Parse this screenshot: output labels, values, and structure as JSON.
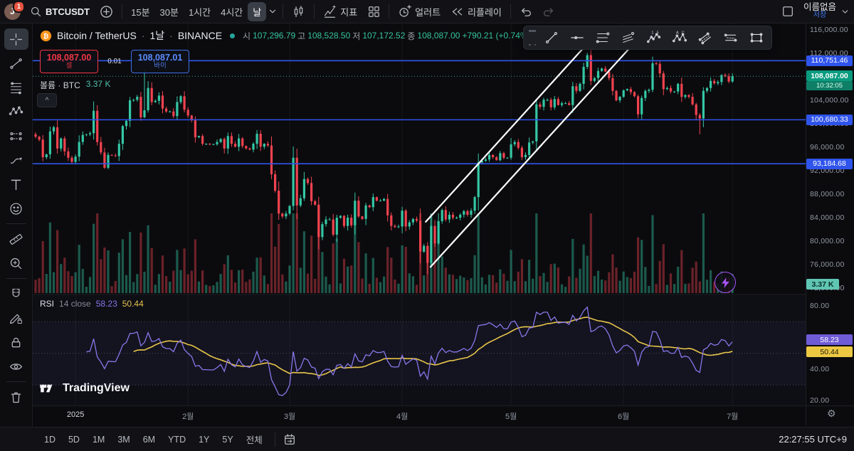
{
  "topbar": {
    "badge": "1",
    "avatar_letter": "J",
    "symbol": "BTCUSDT",
    "intervals": [
      "15분",
      "30분",
      "1시간",
      "4시간",
      "날"
    ],
    "selected_interval": "날",
    "indicators_label": "지표",
    "alert_label": "얼러트",
    "replay_label": "리플레이",
    "layout_name": "이름없음",
    "save_label": "저장"
  },
  "legend": {
    "name": "Bitcoin / TetherUS",
    "sep": "·",
    "interval": "1날",
    "exchange": "BINANCE",
    "o_label": "시",
    "o": "107,296.79",
    "h_label": "고",
    "h": "108,528.50",
    "l_label": "저",
    "l": "107,172.52",
    "c_label": "종",
    "c": "108,087.00",
    "change": "+790.21 (+0.74%)"
  },
  "volume_row": {
    "label": "볼륨 · BTC",
    "value": "3.37 K"
  },
  "rsi_row": {
    "title": "RSI",
    "params": "14 close",
    "v1": "58.23",
    "v2": "50.44"
  },
  "trade": {
    "sell_price": "108,087.00",
    "sell_label": "셀",
    "spread": "0.01",
    "buy_price": "108,087.01",
    "buy_label": "바이"
  },
  "logo_text": "TradingView",
  "collapse_glyph": "^",
  "gear_glyph": "⚙",
  "bottombar": {
    "ranges": [
      "1D",
      "5D",
      "1M",
      "3M",
      "6M",
      "YTD",
      "1Y",
      "5Y",
      "전체"
    ],
    "clock": "22:27:55 UTC+9"
  },
  "price_axis": {
    "ticks": [
      {
        "label": "116,000.00",
        "v": 116000
      },
      {
        "label": "112,000.00",
        "v": 112000
      },
      {
        "label": "104,000.00",
        "v": 104000
      },
      {
        "label": "100,000.00",
        "v": 100000
      },
      {
        "label": "96,000.00",
        "v": 96000
      },
      {
        "label": "92,000.00",
        "v": 92000
      },
      {
        "label": "88,000.00",
        "v": 88000
      },
      {
        "label": "84,000.00",
        "v": 84000
      },
      {
        "label": "80,000.00",
        "v": 80000
      },
      {
        "label": "76,000.00",
        "v": 76000
      },
      {
        "label": "72,000.00",
        "v": 72000
      }
    ],
    "rsi_ticks": [
      {
        "label": "80.00",
        "v": 80
      },
      {
        "label": "40.00",
        "v": 40
      },
      {
        "label": "20.00",
        "v": 20
      }
    ],
    "level_labels": [
      {
        "label": "110,751.46",
        "v": 110751.46
      },
      {
        "label": "100,680.33",
        "v": 100680.33
      },
      {
        "label": "93,184.68",
        "v": 93184.68
      }
    ],
    "last": {
      "label": "108,087.00",
      "countdown": "10:32:05"
    },
    "volume_label": "3.37 K",
    "rsi_value_labels": [
      {
        "label": "58.23",
        "kind": "rsi"
      },
      {
        "label": "50.44",
        "kind": "rsi-ma"
      }
    ]
  },
  "time_axis": {
    "labels": [
      {
        "text": "2025",
        "i": 11,
        "major": true
      },
      {
        "text": "2월",
        "i": 42
      },
      {
        "text": "3월",
        "i": 70
      },
      {
        "text": "4월",
        "i": 101
      },
      {
        "text": "5월",
        "i": 131
      },
      {
        "text": "6월",
        "i": 162
      },
      {
        "text": "7월",
        "i": 192
      }
    ]
  },
  "left_toolbar_tools": [
    "crosshair",
    "trend-line",
    "fib-retracement",
    "pattern",
    "prediction",
    "brush",
    "text",
    "emoji",
    "ruler",
    "zoom-in",
    "magnet",
    "draw-lock",
    "lock-all",
    "hide-all",
    "delete-all"
  ],
  "float_toolbar_tools": [
    "trend-line",
    "horizontal-line",
    "fib-retracement",
    "fib-channel",
    "elliott-wave",
    "xabcd-pattern",
    "parallel-channel",
    "disjoint-channel",
    "rectangle"
  ],
  "colors": {
    "up": "#34c7a4",
    "down": "#f1434f",
    "blue_line": "#2f54eb",
    "last_price_bg": "#0a9b7f",
    "countdown_bg": "#0e7f66",
    "volume_label_bg": "#5fc6b3",
    "volume_label_fg": "#0b2d27",
    "rsi_line": "#8678e9",
    "rsi_ma": "#e7c64a",
    "rsi_label_bg": "#6f5bd6",
    "rsi_ma_label_bg": "#edc843",
    "channel": "#ffffff",
    "dotted_last": "#3ba98c"
  },
  "chart_data": {
    "type": "candlestick",
    "symbol": "BTCUSDT",
    "exchange": "BINANCE",
    "interval": "1D",
    "x_start": "2024-12-21",
    "x_end": "2025-07-01",
    "price_range_usd": [
      70000,
      116000
    ],
    "last_price": 108087.0,
    "closes_k_usd": [
      97.8,
      97.3,
      94.3,
      94.8,
      98.7,
      99.4,
      95.8,
      97.5,
      95.3,
      94.2,
      93.5,
      94.4,
      96.9,
      98.1,
      98.2,
      98.4,
      102.2,
      96.9,
      95.1,
      92.5,
      94.7,
      94.6,
      94.5,
      96.6,
      99.6,
      100.5,
      104.0,
      104.1,
      104.6,
      101.1,
      102.3,
      106.1,
      103.7,
      103.9,
      104.8,
      102.6,
      102.1,
      102.1,
      101.3,
      103.7,
      104.7,
      102.4,
      101.4,
      100.6,
      97.7,
      97.9,
      96.6,
      96.6,
      96.5,
      96.5,
      96.9,
      97.4,
      95.8,
      97.9,
      96.6,
      96.1,
      97.5,
      96.2,
      95.8,
      95.6,
      96.6,
      98.3,
      96.1,
      96.6,
      96.3,
      91.4,
      88.6,
      84.7,
      84.2,
      84.7,
      86.0,
      94.2,
      86.1,
      87.3,
      90.6,
      89.9,
      86.8,
      86.2,
      80.7,
      82.9,
      83.7,
      83.7,
      81.1,
      84.0,
      84.3,
      82.6,
      84.0,
      82.7,
      86.9,
      84.2,
      83.8,
      86.1,
      85.8,
      87.5,
      86.9,
      86.9,
      87.2,
      84.4,
      82.6,
      82.4,
      82.5,
      85.2,
      82.5,
      83.2,
      83.8,
      83.5,
      78.2,
      79.2,
      76.3,
      82.6,
      79.6,
      83.4,
      85.3,
      83.7,
      84.5,
      84.0,
      84.0,
      84.5,
      85.1,
      84.5,
      85.2,
      87.5,
      93.4,
      93.7,
      93.9,
      94.7,
      94.3,
      93.8,
      95.0,
      94.2,
      94.2,
      96.5,
      96.9,
      95.9,
      94.3,
      94.7,
      96.8,
      97.0,
      103.3,
      102.9,
      104.1,
      104.1,
      102.8,
      104.2,
      103.2,
      103.5,
      103.5,
      103.2,
      106.4,
      105.6,
      106.8,
      109.7,
      111.7,
      107.3,
      107.8,
      109.0,
      109.4,
      108.9,
      107.8,
      105.6,
      104.0,
      104.6,
      105.7,
      105.9,
      105.4,
      104.7,
      101.6,
      104.4,
      105.6,
      105.8,
      110.3,
      110.2,
      108.6,
      105.9,
      106.1,
      105.5,
      105.5,
      106.8,
      104.6,
      104.9,
      104.6,
      103.3,
      101.5,
      100.9,
      105.6,
      106.1,
      107.3,
      106.9,
      107.1,
      108.3,
      108.1,
      107.2,
      108.087
    ],
    "wick_overrides": {
      "30": {
        "high": 109.3
      },
      "108": {
        "low": 74.4
      },
      "152": {
        "high": 112.1
      },
      "183": {
        "low": 98.2
      },
      "192": {
        "low": 107.0,
        "high": 108.6
      }
    },
    "horizontal_lines_usd": [
      110751.46,
      100680.33,
      93184.68
    ],
    "channel_anchors": {
      "line_a": [
        {
          "i": 107.5,
          "p": 83.3
        },
        {
          "i": 154,
          "p": 115.0
        }
      ],
      "line_b": [
        {
          "i": 108.8,
          "p": 75.6
        },
        {
          "i": 165,
          "p": 113.8
        }
      ]
    },
    "volume": {
      "current_label": "3.37 K",
      "current_k": 3.37
    },
    "rsi": {
      "period": 14,
      "source": "close",
      "current": 58.23,
      "ma_current": 50.44,
      "levels": [
        70,
        50,
        30
      ]
    }
  }
}
